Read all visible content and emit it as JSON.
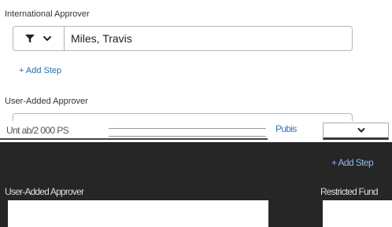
{
  "international_approver": {
    "label": "International Approver",
    "value": "Miles, Travis",
    "filter_icon": "filter-icon",
    "chevron_icon": "chevron-down-icon"
  },
  "add_step": {
    "label": "+ Add Step"
  },
  "user_added_approver": {
    "label": "User-Added Approver",
    "filter_icon": "filter-icon",
    "chevron_icon": "chevron-down-icon"
  },
  "glitched_region": {
    "top_text": "Unt ab/2 000 PS",
    "link_text": "Pubis",
    "add_step_text": "+ Add Step",
    "left_label": "User-Added Approver",
    "right_label": "Restricted Fund"
  }
}
